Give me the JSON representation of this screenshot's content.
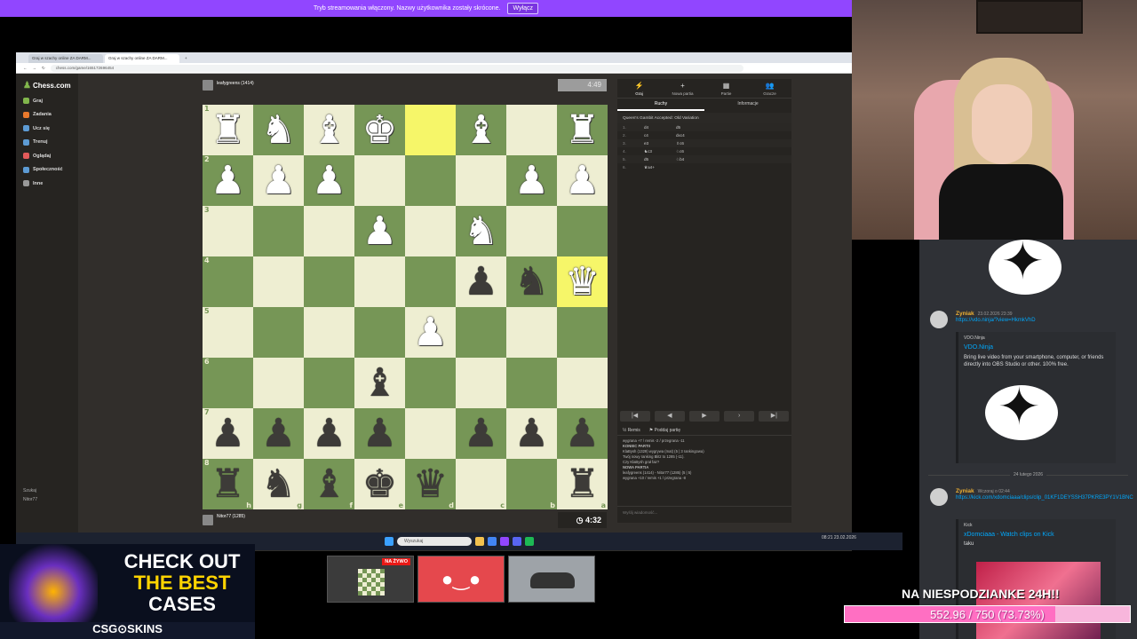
{
  "notice": {
    "text": "Tryb streamowania włączony. Nazwy użytkownika zostały skrócone.",
    "button": "Wyłącz"
  },
  "browser": {
    "tabs": [
      "Graj w szachy online ZA DARM...",
      "Graj w szachy online ZA DARM..."
    ],
    "url": "chess.com/game/165172696454"
  },
  "sidebar": {
    "logo": "Chess.com",
    "items": [
      {
        "label": "Graj",
        "color": "#81b64c"
      },
      {
        "label": "Zadania",
        "color": "#e9792c"
      },
      {
        "label": "Ucz się",
        "color": "#5d9bd4"
      },
      {
        "label": "Trenuj",
        "color": "#5d9bd4"
      },
      {
        "label": "Oglądaj",
        "color": "#e35a5a"
      },
      {
        "label": "Społeczność",
        "color": "#5d9bd4"
      },
      {
        "label": "Inne",
        "color": "#999999"
      }
    ],
    "bottom": [
      "Szukaj",
      "Nitor77"
    ]
  },
  "top_player": {
    "name": "leafygreens (1414)",
    "clock": "4:49"
  },
  "bottom_player": {
    "name": "Nitor77 (1285)",
    "clock": "4:32"
  },
  "board": {
    "ranks": [
      "1",
      "2",
      "3",
      "4",
      "5",
      "6",
      "7",
      "8"
    ],
    "files": [
      "h",
      "g",
      "f",
      "e",
      "d",
      "c",
      "b",
      "a"
    ],
    "squares": [
      [
        "wR",
        "wN",
        "wB",
        "wK",
        "",
        "wB",
        "",
        "wR"
      ],
      [
        "wP",
        "wP",
        "wP",
        "",
        "",
        "",
        "wP",
        "wP"
      ],
      [
        "",
        "",
        "",
        "wP",
        "",
        "wN",
        "",
        ""
      ],
      [
        "",
        "",
        "",
        "",
        "",
        "bP",
        "bN",
        "wQ"
      ],
      [
        "",
        "",
        "",
        "",
        "wP",
        "",
        "",
        ""
      ],
      [
        "",
        "",
        "",
        "bB",
        "",
        "",
        "",
        ""
      ],
      [
        "bP",
        "bP",
        "bP",
        "bP",
        "",
        "bP",
        "bP",
        "bP"
      ],
      [
        "bR",
        "bN",
        "bB",
        "bK",
        "bQ",
        "",
        "",
        "bR"
      ]
    ],
    "highlights": [
      [
        0,
        4
      ],
      [
        3,
        7
      ]
    ]
  },
  "panel": {
    "tabs": [
      {
        "icon": "⚡",
        "label": "Graj"
      },
      {
        "icon": "+",
        "label": "Nowa partia"
      },
      {
        "icon": "▦",
        "label": "Partie"
      },
      {
        "icon": "👥",
        "label": "Gracze"
      }
    ],
    "subtabs": [
      "Ruchy",
      "Informacje"
    ],
    "opening": "Queen's Gambit Accepted: Old Variation",
    "moves": [
      {
        "n": "1.",
        "w": "d4",
        "b": "d5"
      },
      {
        "n": "2.",
        "w": "c4",
        "b": "dxc4"
      },
      {
        "n": "3.",
        "w": "e3",
        "b": "♗c6"
      },
      {
        "n": "4.",
        "w": "♞c3",
        "b": "♘c6"
      },
      {
        "n": "5.",
        "w": "d5",
        "b": "♘b4"
      },
      {
        "n": "6.",
        "w": "♛a4+",
        "b": ""
      }
    ],
    "nav": [
      "|◀",
      "◀",
      "▶",
      "›",
      "▶|"
    ],
    "actions": [
      "Remis",
      "Poddaj partię"
    ],
    "log": [
      "wygrana +7 / remis -2 / przegrana -11",
      "KONIEC PARTII",
      "KlaBysh (1329) wygrywa (mat) (5 | 3 rankingowa)",
      "Twój nowy ranking Blitz to 1285 (-11).",
      "Czy KlaBysh grał fair?",
      "NOWA PARTIA",
      "leafygreens (1414) - Nitor77 (1285) (5 | 5)",
      "wygrana +10 / remis +1 / przegrana -8"
    ],
    "chat_placeholder": "Wyślij wiadomość..."
  },
  "taskbar": {
    "search": "Wyszukaj",
    "time": "08:21",
    "date": "23.02.2026"
  },
  "discord": {
    "msg1": {
      "user": "Zyniak",
      "time": "23.02.2026 23:39",
      "link": "https://vdo.ninja/?view=HkmkVhD",
      "site": "VDO.Ninja",
      "title": "VDO.Ninja",
      "desc": "Bring live video from your smartphone, computer, or friends directly into OBS Studio or other. 100% free."
    },
    "day": "24 lutego 2026",
    "msg2": {
      "user": "Zyniak",
      "time": "Wczoraj o 02:44",
      "link": "https://kick.com/xdomciaaa/clips/clip_01KF1DEYSSH37PKRE3PY1V1BNC",
      "site": "Kick",
      "title": "xDomciaaa - Watch clips on Kick",
      "desc": "taku"
    }
  },
  "ad": {
    "line1": "CHECK OUT",
    "line2": "THE BEST",
    "line3": "CASES",
    "brand": "CSG⊙SKINS"
  },
  "thumb_live": "NA ŻYWO",
  "goal": {
    "title": "NA NIESPODZIANKE 24H!!",
    "text": "552.96 / 750 (73.73%)",
    "progress": 0.7373
  }
}
